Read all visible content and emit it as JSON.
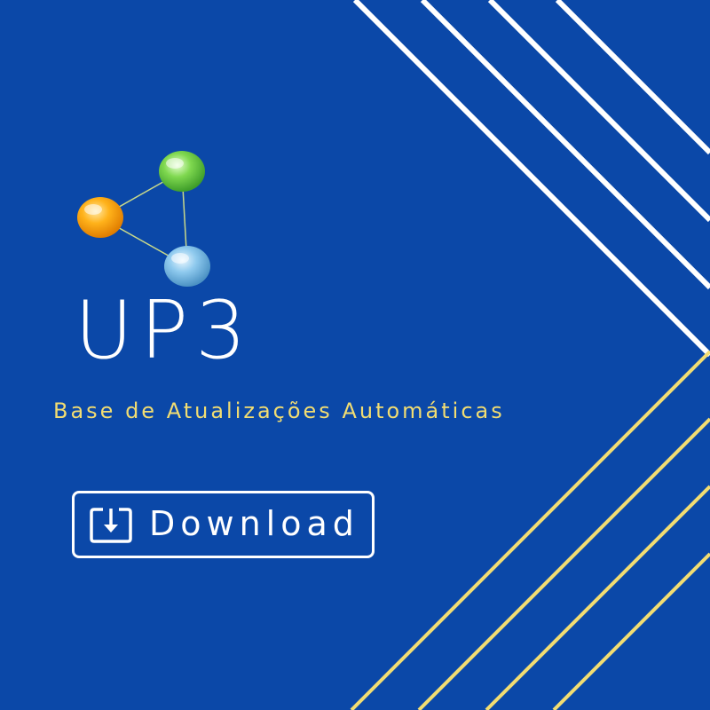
{
  "brand": {
    "name": "UP3",
    "tagline": "Base de Atualizações Automáticas",
    "logo_icon": "molecule-network-icon"
  },
  "download_button": {
    "label": "Download",
    "icon": "download-icon"
  },
  "colors": {
    "background": "#0b48a8",
    "stripe_white": "#ffffff",
    "stripe_yellow": "#f2dd72",
    "tagline": "#f2dd72",
    "node_orange": "#f5a300",
    "node_green": "#6fd04a",
    "node_blue": "#7ec0e8"
  }
}
